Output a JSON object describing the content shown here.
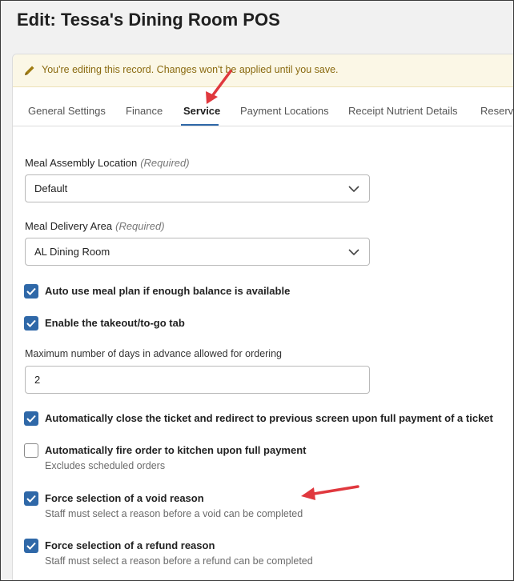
{
  "page": {
    "title": "Edit: Tessa's Dining Room POS"
  },
  "banner": {
    "icon": "pencil-icon",
    "text": "You're editing this record. Changes won't be applied until you save."
  },
  "tabs": [
    {
      "label": "General Settings",
      "active": false
    },
    {
      "label": "Finance",
      "active": false
    },
    {
      "label": "Service",
      "active": true
    },
    {
      "label": "Payment Locations",
      "active": false
    },
    {
      "label": "Receipt Nutrient Details",
      "active": false
    },
    {
      "label": "Reserv",
      "active": false
    }
  ],
  "form": {
    "assembly": {
      "label": "Meal Assembly Location",
      "required": "(Required)",
      "value": "Default"
    },
    "delivery": {
      "label": "Meal Delivery Area",
      "required": "(Required)",
      "value": "AL Dining Room"
    },
    "checks": [
      {
        "label": "Auto use meal plan if enough balance is available",
        "checked": true,
        "help": ""
      },
      {
        "label": "Enable the takeout/to-go tab",
        "checked": true,
        "help": ""
      },
      {
        "label": "Automatically close the ticket and redirect to previous screen upon full payment of a ticket",
        "checked": true,
        "help": ""
      },
      {
        "label": "Automatically fire order to kitchen upon full payment",
        "checked": false,
        "help": "Excludes scheduled orders"
      },
      {
        "label": "Force selection of a void reason",
        "checked": true,
        "help": "Staff must select a reason before a void can be completed"
      },
      {
        "label": "Force selection of a refund reason",
        "checked": true,
        "help": "Staff must select a reason before a refund can be completed"
      }
    ],
    "advance_days": {
      "label": "Maximum number of days in advance allowed for ordering",
      "value": "2"
    }
  },
  "colors": {
    "accent": "#2f68a8",
    "annotation_arrow": "#e0383e",
    "banner_bg": "#fbf7e6",
    "banner_text": "#8a6a10"
  }
}
